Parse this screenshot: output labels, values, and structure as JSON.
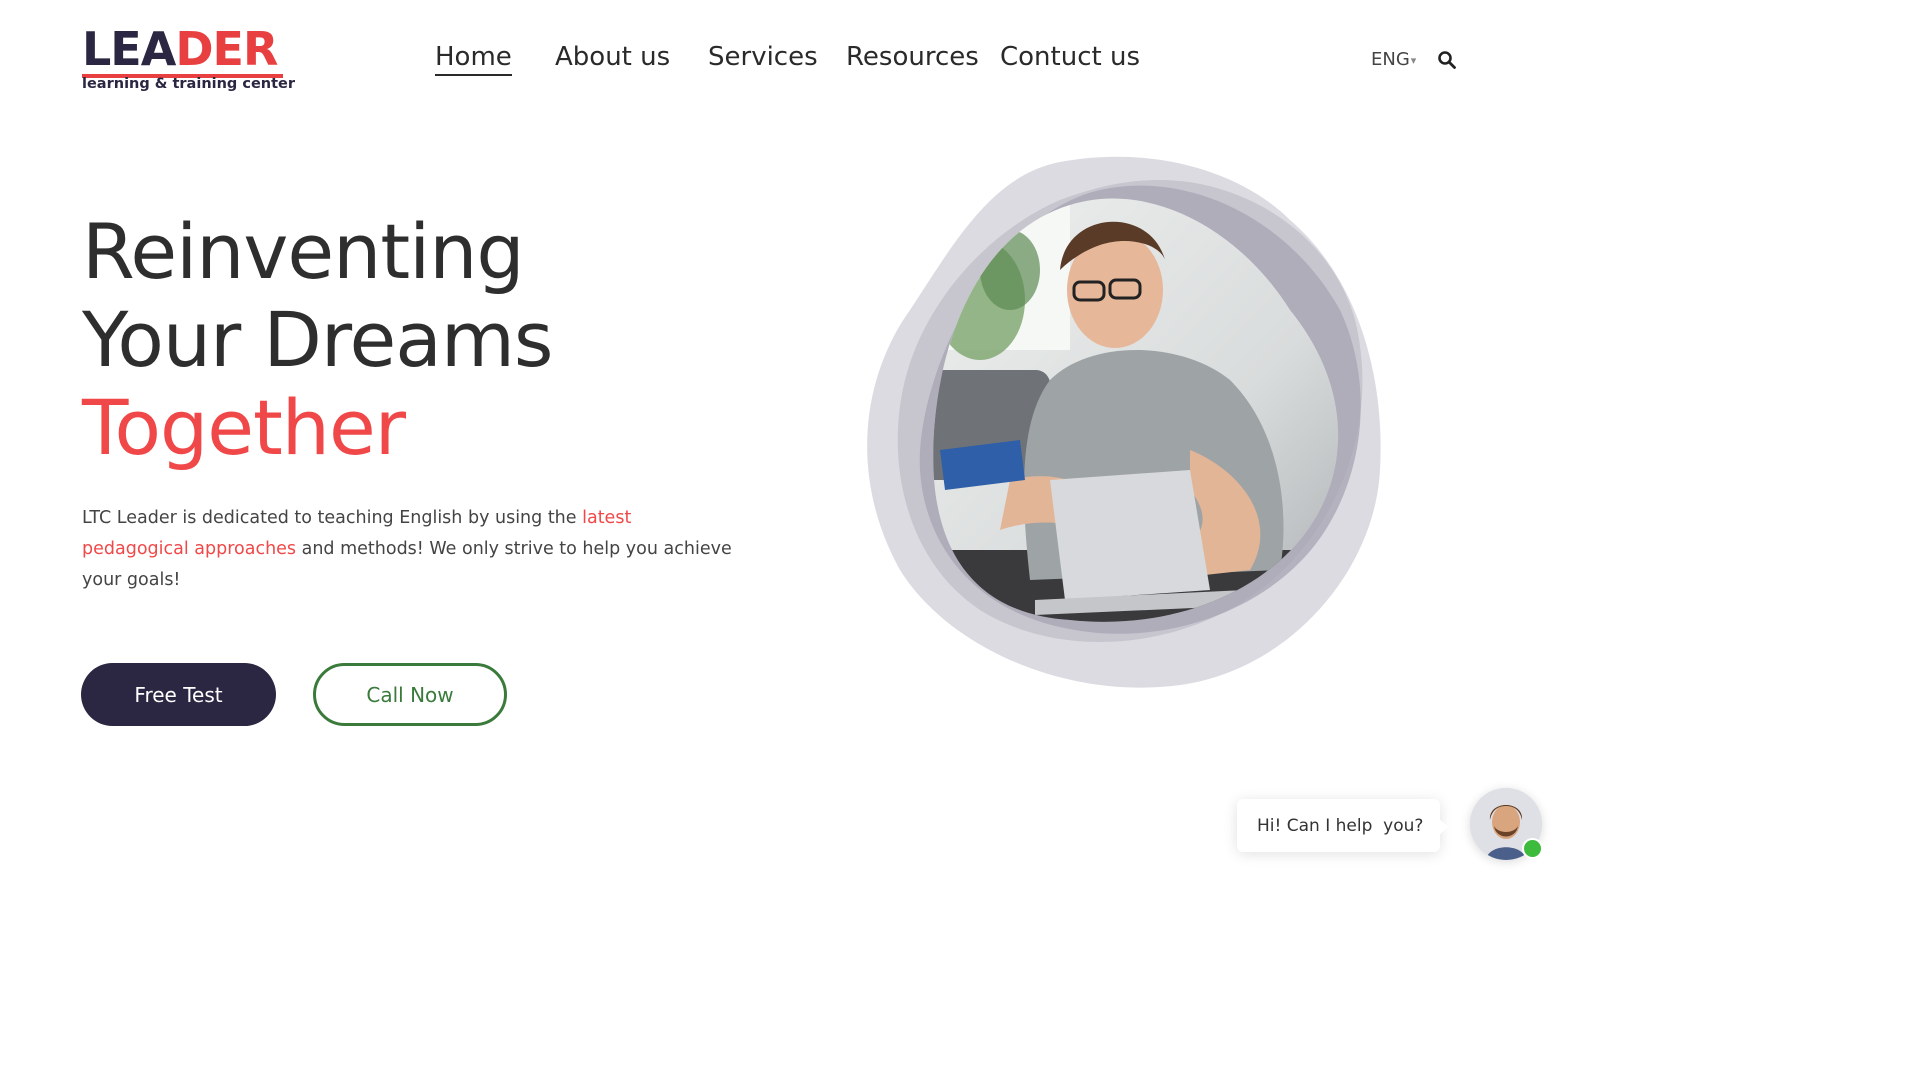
{
  "brand": {
    "logo_part1": "LEA",
    "logo_part2": "DER",
    "tagline": "learning & training center"
  },
  "nav": {
    "items": [
      {
        "label": "Home",
        "active": true
      },
      {
        "label": "About us"
      },
      {
        "label": "Services"
      },
      {
        "label": "Resources"
      },
      {
        "label": "Contuct us"
      }
    ],
    "language": "ENG",
    "language_caret": "▾",
    "search_icon": "search-icon"
  },
  "hero": {
    "title_line1": "Reinventing",
    "title_line2": "Your Dreams",
    "title_line3": "Together",
    "text_before": "LTC Leader is dedicated to teaching English by using the ",
    "text_link": "latest pedagogical approaches",
    "text_after": " and methods! We only strive to help you achieve your goals!",
    "primary_button": "Free Test",
    "secondary_button": "Call Now"
  },
  "chat": {
    "message": "Hi! Can I help  you?",
    "status": "online"
  },
  "colors": {
    "brand_dark": "#2b2642",
    "accent_red": "#f04848",
    "call_green": "#3a7a3a",
    "online_green": "#3dbb3d"
  }
}
